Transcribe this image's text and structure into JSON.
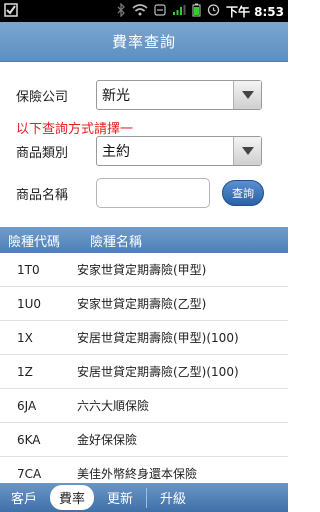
{
  "status": {
    "time": "下午 8:53"
  },
  "title": "費率查詢",
  "form": {
    "company_label": "保險公司",
    "company_value": "新光",
    "hint": "以下查詢方式請擇一",
    "category_label": "商品類別",
    "category_value": "主約",
    "name_label": "商品名稱",
    "name_value": "",
    "query_label": "查詢"
  },
  "table": {
    "headers": [
      "險種代碼",
      "險種名稱"
    ],
    "rows": [
      {
        "code": "1T0",
        "name": "安家世貸定期壽險(甲型)"
      },
      {
        "code": "1U0",
        "name": "安家世貸定期壽險(乙型)"
      },
      {
        "code": "1X",
        "name": "安居世貸定期壽險(甲型)(100)"
      },
      {
        "code": "1Z",
        "name": "安居世貸定期壽險(乙型)(100)"
      },
      {
        "code": "6JA",
        "name": "六六大順保險"
      },
      {
        "code": "6KA",
        "name": "金好保保險"
      },
      {
        "code": "7CA",
        "name": "美佳外幣終身還本保險"
      }
    ]
  },
  "tabs": [
    {
      "label": "客戶"
    },
    {
      "label": "費率"
    },
    {
      "label": "更新"
    },
    {
      "label": "升級"
    }
  ]
}
